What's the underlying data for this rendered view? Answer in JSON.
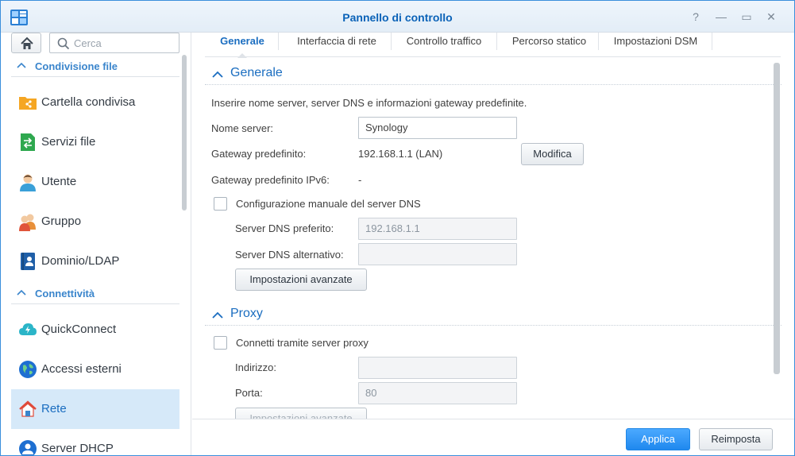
{
  "window": {
    "title": "Pannello di controllo",
    "buttons": {
      "help": "?",
      "minimize": "—",
      "maximize": "▭",
      "close": "✕"
    }
  },
  "sidebar": {
    "search_placeholder": "Cerca",
    "groups": [
      {
        "label": "Condivisione file"
      },
      {
        "label": "Connettività"
      }
    ],
    "items": [
      {
        "label": "Cartella condivisa",
        "icon": "shared-folder-icon"
      },
      {
        "label": "Servizi file",
        "icon": "file-services-icon"
      },
      {
        "label": "Utente",
        "icon": "user-icon"
      },
      {
        "label": "Gruppo",
        "icon": "group-icon"
      },
      {
        "label": "Dominio/LDAP",
        "icon": "domain-ldap-icon"
      },
      {
        "label": "QuickConnect",
        "icon": "quickconnect-icon"
      },
      {
        "label": "Accessi esterni",
        "icon": "external-access-icon"
      },
      {
        "label": "Rete",
        "icon": "network-icon",
        "active": true
      },
      {
        "label": "Server DHCP",
        "icon": "dhcp-server-icon"
      }
    ]
  },
  "tabs": [
    {
      "label": "Generale",
      "active": true
    },
    {
      "label": "Interfaccia di rete"
    },
    {
      "label": "Controllo traffico"
    },
    {
      "label": "Percorso statico"
    },
    {
      "label": "Impostazioni DSM"
    }
  ],
  "general": {
    "section_title": "Generale",
    "description": "Inserire nome server, server DNS e informazioni gateway predefinite.",
    "server_name_label": "Nome server:",
    "server_name_value": "Synology",
    "gateway_label": "Gateway predefinito:",
    "gateway_value": "192.168.1.1 (LAN)",
    "edit_button": "Modifica",
    "gateway_ipv6_label": "Gateway predefinito IPv6:",
    "gateway_ipv6_value": "-",
    "manual_dns_label": "Configurazione manuale del server DNS",
    "preferred_dns_label": "Server DNS preferito:",
    "preferred_dns_value": "192.168.1.1",
    "alternate_dns_label": "Server DNS alternativo:",
    "alternate_dns_value": "",
    "advanced_button": "Impostazioni avanzate"
  },
  "proxy": {
    "section_title": "Proxy",
    "connect_label": "Connetti tramite server proxy",
    "address_label": "Indirizzo:",
    "address_value": "",
    "port_label": "Porta:",
    "port_value": "80",
    "advanced_button": "Impostazioni avanzate"
  },
  "footer": {
    "apply_button": "Applica",
    "reset_button": "Reimposta"
  },
  "colors": {
    "accent": "#1a6dc0",
    "primary_button": "#2e95f5",
    "active_item_bg": "#d6e9f9"
  }
}
